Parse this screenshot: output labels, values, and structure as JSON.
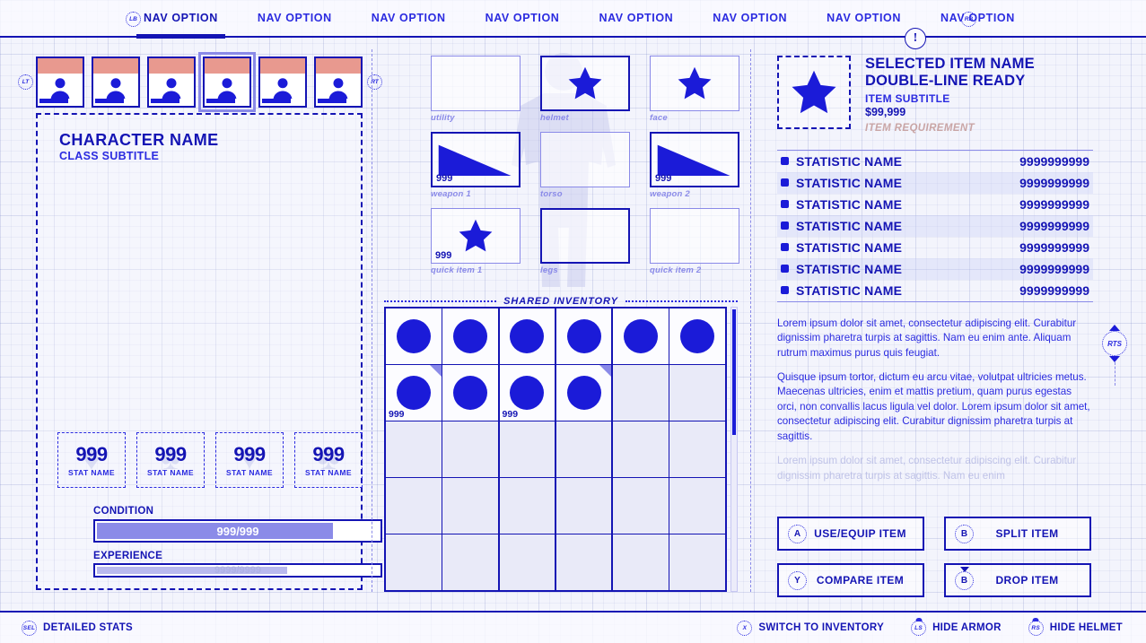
{
  "nav": {
    "left_bumper": "LB",
    "right_bumper": "RB",
    "alert": "!",
    "items": [
      {
        "label": "NAV OPTION",
        "active": true
      },
      {
        "label": "NAV OPTION",
        "active": false
      },
      {
        "label": "NAV OPTION",
        "active": false
      },
      {
        "label": "NAV OPTION",
        "active": false
      },
      {
        "label": "NAV OPTION",
        "active": false
      },
      {
        "label": "NAV OPTION",
        "active": false
      },
      {
        "label": "NAV OPTION",
        "active": false
      },
      {
        "label": "NAV OPTION",
        "active": false
      }
    ]
  },
  "party": {
    "prev_trigger": "LT",
    "next_trigger": "RT",
    "members": [
      {
        "selected": false
      },
      {
        "selected": false
      },
      {
        "selected": false
      },
      {
        "selected": true
      },
      {
        "selected": false
      },
      {
        "selected": false
      }
    ]
  },
  "character": {
    "name": "CHARACTER NAME",
    "subtitle": "CLASS SUBTITLE",
    "stats": [
      {
        "value": "999",
        "label": "STAT NAME",
        "suit": "♦"
      },
      {
        "value": "999",
        "label": "STAT NAME",
        "suit": "♠"
      },
      {
        "value": "999",
        "label": "STAT NAME",
        "suit": "♥"
      },
      {
        "value": "999",
        "label": "STAT NAME",
        "suit": "♣"
      }
    ],
    "condition": {
      "label": "CONDITION",
      "value": "999/999",
      "percent": 84
    },
    "experience": {
      "label": "EXPERIENCE",
      "value": "9999/9999",
      "percent": 68
    }
  },
  "equipment": {
    "slots": [
      {
        "label": "utility",
        "art": "none",
        "qty": "",
        "strong": false,
        "tall": false
      },
      {
        "label": "helmet",
        "art": "star",
        "qty": "",
        "strong": true,
        "tall": false
      },
      {
        "label": "face",
        "art": "star",
        "qty": "",
        "strong": false,
        "tall": false
      },
      {
        "label": "weapon 1",
        "art": "triangle",
        "qty": "999",
        "strong": true,
        "tall": true
      },
      {
        "label": "torso",
        "art": "none",
        "qty": "",
        "strong": false,
        "tall": true
      },
      {
        "label": "weapon 2",
        "art": "triangle",
        "qty": "999",
        "strong": true,
        "tall": true
      },
      {
        "label": "quick item 1",
        "art": "star",
        "qty": "999",
        "strong": false,
        "tall": true
      },
      {
        "label": "legs",
        "art": "none",
        "qty": "",
        "strong": true,
        "tall": true
      },
      {
        "label": "quick item 2",
        "art": "none",
        "qty": "",
        "strong": false,
        "tall": true
      }
    ]
  },
  "inventory": {
    "title": "SHARED INVENTORY",
    "columns": 6,
    "rows": 5,
    "cells": [
      {
        "filled": true,
        "qty": "",
        "corner": false
      },
      {
        "filled": true,
        "qty": "",
        "corner": false
      },
      {
        "filled": true,
        "qty": "",
        "corner": false
      },
      {
        "filled": true,
        "qty": "",
        "corner": false
      },
      {
        "filled": true,
        "qty": "",
        "corner": false
      },
      {
        "filled": true,
        "qty": "",
        "corner": false
      },
      {
        "filled": true,
        "qty": "999",
        "corner": true
      },
      {
        "filled": true,
        "qty": "",
        "corner": false
      },
      {
        "filled": true,
        "qty": "999",
        "corner": false
      },
      {
        "filled": true,
        "qty": "",
        "corner": true
      },
      {
        "filled": false,
        "qty": "",
        "corner": false
      },
      {
        "filled": false,
        "qty": "",
        "corner": false
      },
      {
        "filled": false,
        "qty": "",
        "corner": false
      },
      {
        "filled": false,
        "qty": "",
        "corner": false
      },
      {
        "filled": false,
        "qty": "",
        "corner": false
      },
      {
        "filled": false,
        "qty": "",
        "corner": false
      },
      {
        "filled": false,
        "qty": "",
        "corner": false
      },
      {
        "filled": false,
        "qty": "",
        "corner": false
      },
      {
        "filled": false,
        "qty": "",
        "corner": false
      },
      {
        "filled": false,
        "qty": "",
        "corner": false
      },
      {
        "filled": false,
        "qty": "",
        "corner": false
      },
      {
        "filled": false,
        "qty": "",
        "corner": false
      },
      {
        "filled": false,
        "qty": "",
        "corner": false
      },
      {
        "filled": false,
        "qty": "",
        "corner": false
      },
      {
        "filled": false,
        "qty": "",
        "corner": false
      },
      {
        "filled": false,
        "qty": "",
        "corner": false
      },
      {
        "filled": false,
        "qty": "",
        "corner": false
      },
      {
        "filled": false,
        "qty": "",
        "corner": false
      },
      {
        "filled": false,
        "qty": "",
        "corner": false
      },
      {
        "filled": false,
        "qty": "",
        "corner": false
      }
    ]
  },
  "item": {
    "name": "SELECTED ITEM NAME DOUBLE-LINE READY",
    "name_line1": "SELECTED ITEM NAME",
    "name_line2": "DOUBLE-LINE READY",
    "subtitle": "ITEM SUBTITLE",
    "price": "$99,999",
    "requirement": "ITEM REQUIREMENT",
    "statistics": [
      {
        "name": "STATISTIC NAME",
        "value": "9999999999"
      },
      {
        "name": "STATISTIC NAME",
        "value": "9999999999"
      },
      {
        "name": "STATISTIC NAME",
        "value": "9999999999"
      },
      {
        "name": "STATISTIC NAME",
        "value": "9999999999"
      },
      {
        "name": "STATISTIC NAME",
        "value": "9999999999"
      },
      {
        "name": "STATISTIC NAME",
        "value": "9999999999"
      },
      {
        "name": "STATISTIC NAME",
        "value": "9999999999"
      }
    ],
    "description": [
      "Lorem ipsum dolor sit amet, consectetur adipiscing elit. Curabitur dignissim pharetra turpis at sagittis. Nam eu enim ante. Aliquam rutrum maximus purus quis feugiat.",
      "Quisque ipsum tortor, dictum eu arcu vitae, volutpat ultricies metus. Maecenas ultricies, enim et mattis pretium, quam purus egestas orci, non convallis lacus ligula vel dolor. Lorem ipsum dolor sit amet, consectetur adipiscing elit. Curabitur dignissim pharetra turpis at sagittis.",
      "Lorem ipsum dolor sit amet, consectetur adipiscing elit. Curabitur dignissim pharetra turpis at sagittis. Nam eu enim"
    ]
  },
  "actions": [
    {
      "glyph": "A",
      "label": "USE/EQUIP ITEM",
      "arrow": false
    },
    {
      "glyph": "B",
      "label": "SPLIT ITEM",
      "arrow": false
    },
    {
      "glyph": "Y",
      "label": "COMPARE ITEM",
      "arrow": false
    },
    {
      "glyph": "B",
      "label": "DROP ITEM",
      "arrow": true
    }
  ],
  "scroll_hint": {
    "label": "RTS"
  },
  "footer": {
    "left": [
      {
        "glyph": "SEL",
        "label": "DETAILED STATS",
        "cap": false
      }
    ],
    "right": [
      {
        "glyph": "X",
        "label": "SWITCH TO INVENTORY",
        "cap": false
      },
      {
        "glyph": "LS",
        "label": "HIDE ARMOR",
        "cap": true
      },
      {
        "glyph": "RS",
        "label": "HIDE HELMET",
        "cap": true
      }
    ]
  },
  "colors": {
    "accent": "#1b1bd8",
    "accent_deep": "#1414b4",
    "salmon": "#e8998f",
    "background": "#f2f3fb",
    "requirement_text": "#c9a5a5"
  }
}
